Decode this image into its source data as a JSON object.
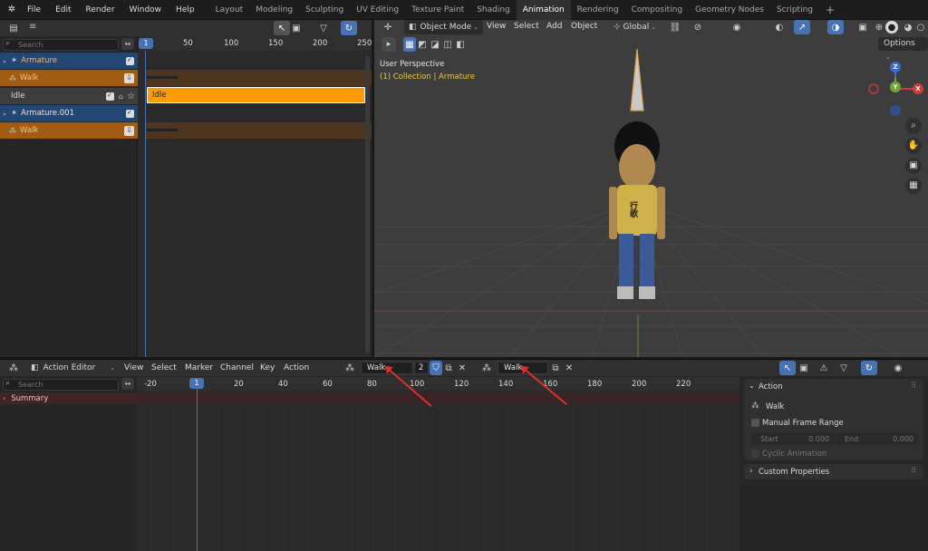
{
  "topbar": {
    "menus": [
      "File",
      "Edit",
      "Render",
      "Window",
      "Help"
    ],
    "workspaces": [
      "Layout",
      "Modeling",
      "Sculpting",
      "UV Editing",
      "Texture Paint",
      "Shading",
      "Animation",
      "Rendering",
      "Compositing",
      "Geometry Nodes",
      "Scripting"
    ],
    "active_workspace": "Animation",
    "add_tab": "+"
  },
  "nla": {
    "search_placeholder": "Search",
    "current_frame": "1",
    "ruler": [
      "50",
      "100",
      "150",
      "200",
      "250"
    ],
    "channels": [
      {
        "label": "Armature",
        "kind": "object"
      },
      {
        "label": "Walk",
        "kind": "action"
      },
      {
        "label": "Idle",
        "kind": "track"
      },
      {
        "label": "Armature.001",
        "kind": "object"
      },
      {
        "label": "Walk",
        "kind": "action"
      }
    ],
    "strip_label": "Idle"
  },
  "viewport": {
    "mode": "Object Mode",
    "menus": [
      "View",
      "Select",
      "Add",
      "Object"
    ],
    "orientation": "Global",
    "options": "Options",
    "info_title": "User Perspective",
    "info_collection": "(1) Collection | Armature",
    "gizmo": {
      "z": "Z",
      "y": "Y",
      "x": "X"
    },
    "shirt_text": "行歌"
  },
  "dopesheet": {
    "editor_mode": "Action Editor",
    "menus": [
      "View",
      "Select",
      "Marker",
      "Channel",
      "Key",
      "Action"
    ],
    "action_name_1": "Walk",
    "user_count": "2",
    "action_name_2": "Walk",
    "search_placeholder": "Search",
    "summary_label": "Summary",
    "ruler": [
      "-20",
      "1",
      "20",
      "40",
      "60",
      "80",
      "100",
      "120",
      "140",
      "160",
      "180",
      "200",
      "220"
    ],
    "sidebar": {
      "action_panel": "Action",
      "action_name": "Walk",
      "manual_frame_range": "Manual Frame Range",
      "start_label": "Start",
      "start_value": "0.000",
      "end_label": "End",
      "end_value": "0.000",
      "cyclic": "Cyclic Animation",
      "custom_properties": "Custom Properties"
    }
  },
  "colors": {
    "accent": "#4772b3",
    "strip_orange": "#ff9b05",
    "annotation_arrow": "#e0302a"
  }
}
